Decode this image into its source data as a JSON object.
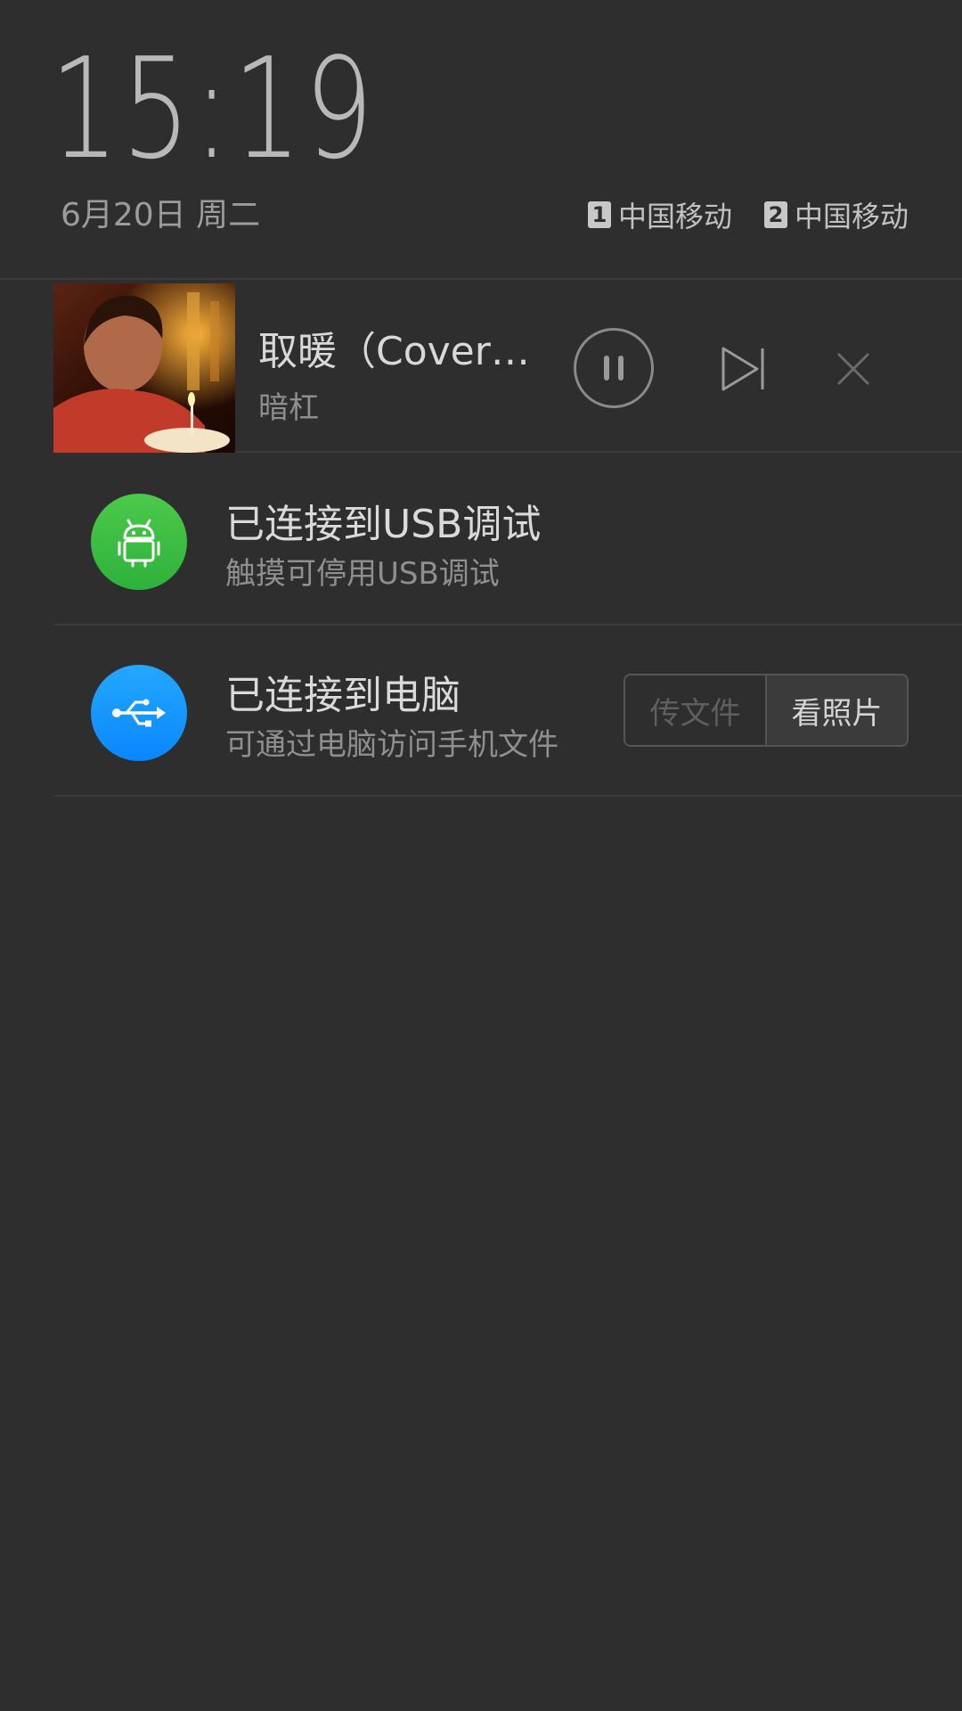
{
  "header": {
    "time": "15:19",
    "date": "6月20日 周二",
    "carriers": [
      {
        "sim": "1",
        "name": "中国移动"
      },
      {
        "sim": "2",
        "name": "中国移动"
      }
    ]
  },
  "music": {
    "title": "取暖（Cover…",
    "artist": "暗杠",
    "icons": {
      "album": "album-art",
      "pause": "pause-icon",
      "next": "skip-next-icon",
      "close": "close-icon"
    }
  },
  "notifications": [
    {
      "title": "已连接到USB调试",
      "subtitle": "触摸可停用USB调试",
      "icon": "android-icon",
      "color": "#2eb13b"
    },
    {
      "title": "已连接到电脑",
      "subtitle": "可通过电脑访问手机文件",
      "icon": "usb-icon",
      "color": "#0b86ff",
      "buttons": {
        "transfer_files": "传文件",
        "view_photos": "看照片"
      }
    }
  ],
  "colors": {
    "background": "#2e2e2e",
    "divider": "#3a3a3a"
  }
}
